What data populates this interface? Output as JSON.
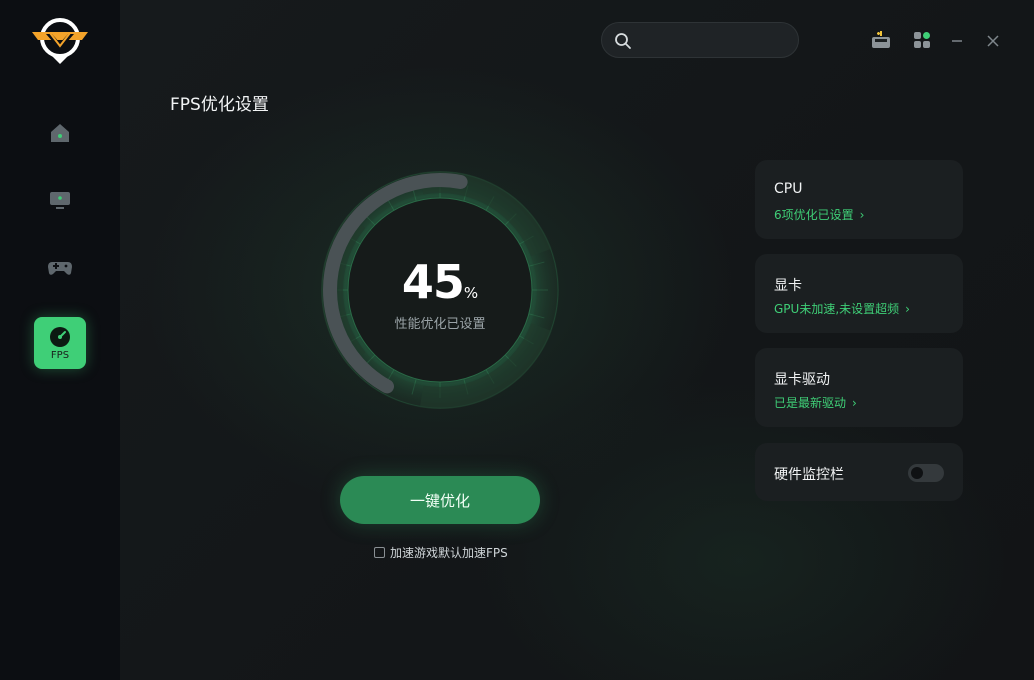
{
  "sidebar": {
    "items": [
      {
        "name": "home",
        "label": ""
      },
      {
        "name": "monitor",
        "label": ""
      },
      {
        "name": "gamepad",
        "label": ""
      },
      {
        "name": "fps",
        "label": "FPS",
        "active": true
      }
    ]
  },
  "header": {
    "search": {
      "placeholder": "",
      "value": ""
    }
  },
  "main": {
    "title": "FPS优化设置",
    "gauge": {
      "value": "45",
      "value_fraction": 0.45,
      "unit": "%",
      "label": "性能优化已设置"
    },
    "optimize_button": "一键优化",
    "checkbox": {
      "label": "加速游戏默认加速FPS",
      "checked": false
    }
  },
  "cards": [
    {
      "title": "CPU",
      "subtitle": "6项优化已设置"
    },
    {
      "title": "显卡",
      "subtitle": "GPU未加速,未设置超频"
    },
    {
      "title": "显卡驱动",
      "subtitle": "已是最新驱动"
    },
    {
      "title": "硬件监控栏",
      "toggle_on": false
    }
  ],
  "colors": {
    "accent": "#3fcf77",
    "button": "#2b8a55",
    "logo_orange": "#f4a32a",
    "card_bg": "#1b1f21"
  }
}
